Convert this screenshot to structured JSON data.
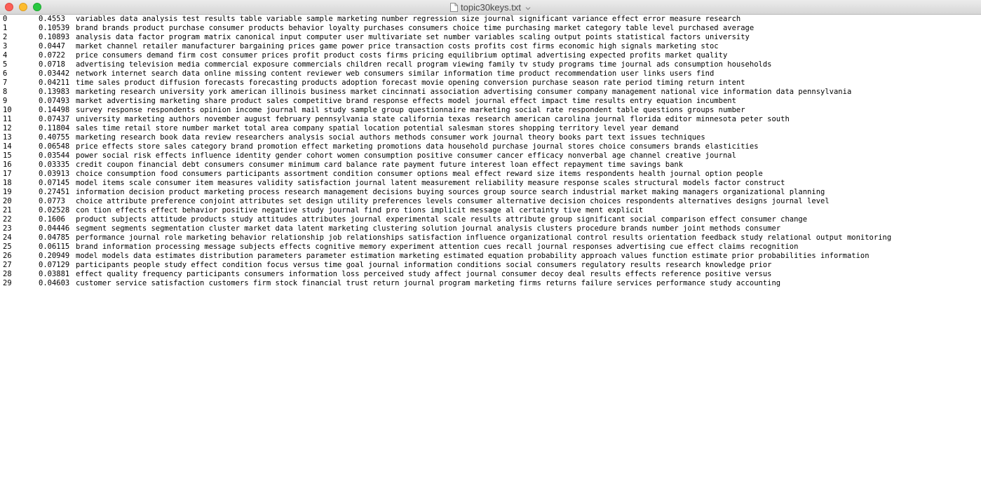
{
  "window": {
    "title": "topic30keys.txt"
  },
  "icons": {
    "close": "close-button-red",
    "minimize": "minimize-button-yellow",
    "zoom": "zoom-button-green",
    "document": "document-icon",
    "chevron": "chevron-down-icon"
  },
  "colors": {
    "close": "#fc5f57",
    "minimize": "#fdbc2e",
    "zoom": "#28c840",
    "text": "#000000",
    "background": "#ffffff"
  },
  "rows": [
    {
      "idx": "0",
      "weight": "0.4553",
      "terms": "variables data analysis test results table variable sample marketing number regression size journal significant variance effect error measure research"
    },
    {
      "idx": "1",
      "weight": "0.10539",
      "terms": "brand brands product purchase consumer products behavior loyalty purchases consumers choice time purchasing market category table level purchased average"
    },
    {
      "idx": "2",
      "weight": "0.10893",
      "terms": "analysis data factor program matrix canonical input computer user multivariate set number variables scaling output points statistical factors university"
    },
    {
      "idx": "3",
      "weight": "0.0447",
      "terms": "market channel retailer manufacturer bargaining prices game power price transaction costs profits cost firms economic high signals marketing stoc"
    },
    {
      "idx": "4",
      "weight": "0.0722",
      "terms": "price consumers demand firm cost consumer prices profit product costs firms pricing equilibrium optimal advertising expected profits market quality"
    },
    {
      "idx": "5",
      "weight": "0.0718",
      "terms": "advertising television media commercial exposure commercials children recall program viewing family tv study programs time journal ads consumption households"
    },
    {
      "idx": "6",
      "weight": "0.03442",
      "terms": "network internet search data online missing content reviewer web consumers similar information time product recommendation user links users find"
    },
    {
      "idx": "7",
      "weight": "0.04211",
      "terms": "time sales product diffusion forecasts forecasting products adoption forecast movie opening conversion purchase season rate period timing return intent"
    },
    {
      "idx": "8",
      "weight": "0.13983",
      "terms": "marketing research university york american illinois business market cincinnati association advertising consumer company management national vice information data pennsylvania"
    },
    {
      "idx": "9",
      "weight": "0.07493",
      "terms": "market advertising marketing share product sales competitive brand response effects model journal effect impact time results entry equation incumbent"
    },
    {
      "idx": "10",
      "weight": "0.14498",
      "terms": "survey response respondents opinion income journal mail study sample group questionnaire marketing social rate respondent table questions groups number"
    },
    {
      "idx": "11",
      "weight": "0.07437",
      "terms": "university marketing authors november august february pennsylvania state california texas research american carolina journal florida editor minnesota peter south"
    },
    {
      "idx": "12",
      "weight": "0.11804",
      "terms": "sales time retail store number market total area company spatial location potential salesman stores shopping territory level year demand"
    },
    {
      "idx": "13",
      "weight": "0.40755",
      "terms": "marketing research book data review researchers analysis social authors methods consumer work journal theory books part text issues techniques"
    },
    {
      "idx": "14",
      "weight": "0.06548",
      "terms": "price effects store sales category brand promotion effect marketing promotions data household purchase journal stores choice consumers brands elasticities"
    },
    {
      "idx": "15",
      "weight": "0.03544",
      "terms": "power social risk effects influence identity gender cohort women consumption positive consumer cancer efficacy nonverbal age channel creative journal"
    },
    {
      "idx": "16",
      "weight": "0.03335",
      "terms": "credit coupon financial debt consumers consumer minimum card balance rate payment future interest loan effect repayment time savings bank"
    },
    {
      "idx": "17",
      "weight": "0.03913",
      "terms": "choice consumption food consumers participants assortment condition consumer options meal effect reward size items respondents health journal option people"
    },
    {
      "idx": "18",
      "weight": "0.07145",
      "terms": "model items scale consumer item measures validity satisfaction journal latent measurement reliability measure response scales structural models factor construct"
    },
    {
      "idx": "19",
      "weight": "0.27451",
      "terms": "information decision product marketing process research management decisions buying sources group source search industrial market making managers organizational planning"
    },
    {
      "idx": "20",
      "weight": "0.0773",
      "terms": "choice attribute preference conjoint attributes set design utility preferences levels consumer alternative decision choices respondents alternatives designs journal level"
    },
    {
      "idx": "21",
      "weight": "0.02528",
      "terms": "con tion effects effect behavior positive negative study journal find pro tions implicit message al certainty tive ment explicit"
    },
    {
      "idx": "22",
      "weight": "0.1606",
      "terms": "product subjects attitude products study attitudes attributes journal experimental scale results attribute group significant social comparison effect consumer change"
    },
    {
      "idx": "23",
      "weight": "0.04446",
      "terms": "segment segments segmentation cluster market data latent marketing clustering solution journal analysis clusters procedure brands number joint methods consumer"
    },
    {
      "idx": "24",
      "weight": "0.04785",
      "terms": "performance journal role marketing behavior relationship job relationships satisfaction influence organizational control results orientation feedback study relational output monitoring"
    },
    {
      "idx": "25",
      "weight": "0.06115",
      "terms": "brand information processing message subjects effects cognitive memory experiment attention cues recall journal responses advertising cue effect claims recognition"
    },
    {
      "idx": "26",
      "weight": "0.20949",
      "terms": "model models data estimates distribution parameters parameter estimation marketing estimated equation probability approach values function estimate prior probabilities information"
    },
    {
      "idx": "27",
      "weight": "0.07129",
      "terms": "participants people study effect condition focus versus time goal journal information conditions social consumers regulatory results research knowledge prior"
    },
    {
      "idx": "28",
      "weight": "0.03881",
      "terms": "effect quality frequency participants consumers information loss perceived study affect journal consumer decoy deal results effects reference positive versus"
    },
    {
      "idx": "29",
      "weight": "0.04603",
      "terms": "customer service satisfaction customers firm stock financial trust return journal program marketing firms returns failure services performance study accounting"
    }
  ]
}
